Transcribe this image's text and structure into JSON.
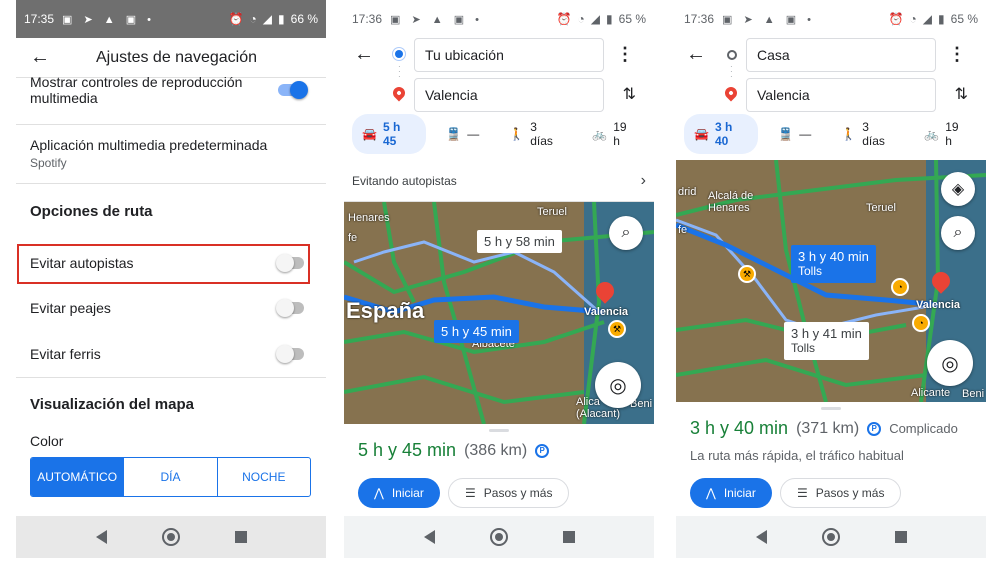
{
  "colors": {
    "accent": "#1a73e8",
    "route_green": "#188038",
    "highlight_border": "#d93025",
    "warning": "#f9ab00"
  },
  "screens": {
    "settings": {
      "status": {
        "time": "17:35",
        "battery": "66 %"
      },
      "title": "Ajustes de navegación",
      "media_controls": {
        "label": "Mostrar controles de reproducción multimedia",
        "on": true
      },
      "default_media": {
        "label": "Aplicación multimedia predeterminada",
        "value": "Spotify"
      },
      "route_options_title": "Opciones de ruta",
      "avoid_highways": {
        "label": "Evitar autopistas",
        "on": false
      },
      "avoid_tolls": {
        "label": "Evitar peajes",
        "on": false
      },
      "avoid_ferries": {
        "label": "Evitar ferris",
        "on": false
      },
      "map_display_title": "Visualización del mapa",
      "color_label": "Color",
      "color_options": [
        "AUTOMÁTICO",
        "DÍA",
        "NOCHE"
      ],
      "color_selected": "AUTOMÁTICO"
    },
    "route_avoid": {
      "status": {
        "time": "17:36",
        "battery": "65 %"
      },
      "from": "Tu ubicación",
      "to": "Valencia",
      "modes": {
        "drive": "5 h 45",
        "transit": "—",
        "walk": "3 días",
        "bike": "19 h"
      },
      "avoid_banner": "Evitando autopistas",
      "map_labels": {
        "country": "España",
        "madrid_area": "fe",
        "henares": "Henares",
        "teruel": "Teruel",
        "valencia": "Valencia",
        "albacete": "Albacete",
        "alicante": "Alica (Alacant)",
        "benidorm": "Beni"
      },
      "alt_route_time": "5 h y 58 min",
      "main_route_time": "5 h y 45 min",
      "summary": {
        "duration": "5 h y 45 min",
        "distance": "(386 km)"
      },
      "start_label": "Iniciar",
      "steps_label": "Pasos y más"
    },
    "route_fast": {
      "status": {
        "time": "17:36",
        "battery": "65 %"
      },
      "from": "Casa",
      "to": "Valencia",
      "modes": {
        "drive": "3 h 40",
        "transit": "—",
        "walk": "3 días",
        "bike": "19 h"
      },
      "map_labels": {
        "madrid": "drid",
        "alcala": "Alcalá de Henares",
        "teruel": "Teruel",
        "valencia": "Valencia",
        "alicante": "Alicante",
        "benidorm": "Beni",
        "fe": "fe"
      },
      "main_route": {
        "time": "3 h y 40 min",
        "tolls": "Tolls"
      },
      "alt_route": {
        "time": "3 h y 41 min",
        "tolls": "Tolls"
      },
      "summary": {
        "duration": "3 h y 40 min",
        "distance": "(371 km)",
        "note": "Complicado"
      },
      "description": "La ruta más rápida, el tráfico habitual",
      "start_label": "Iniciar",
      "steps_label": "Pasos y más"
    }
  }
}
